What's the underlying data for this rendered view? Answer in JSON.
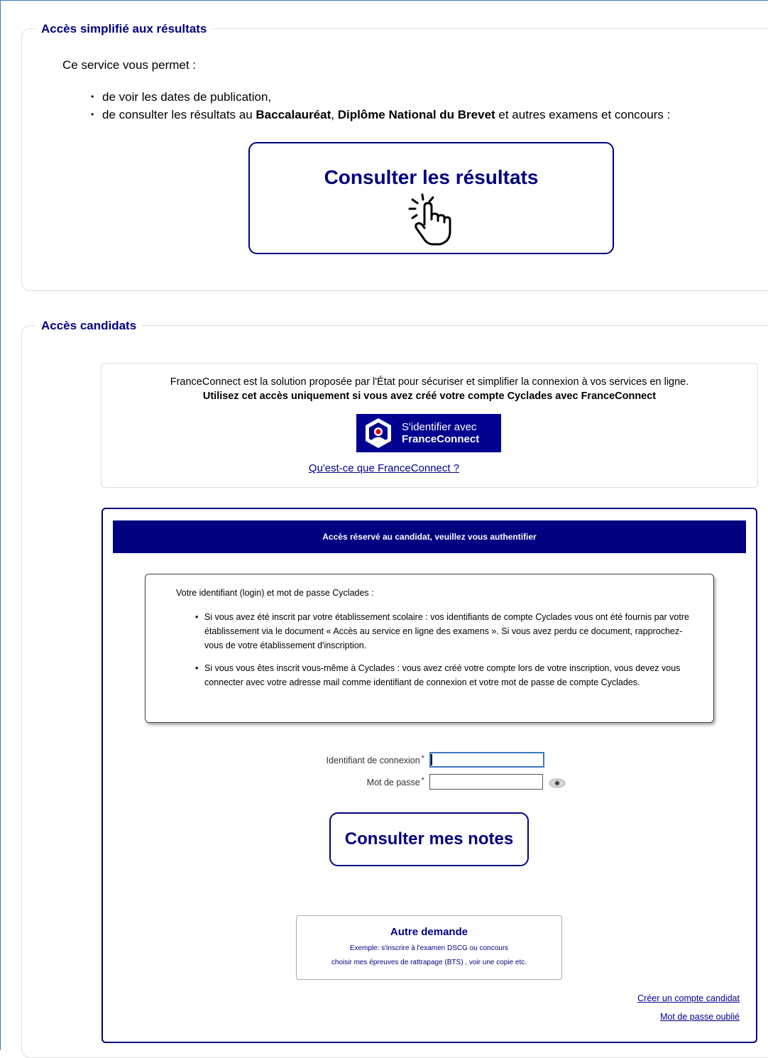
{
  "results_section": {
    "legend": "Accès simplifié aux résultats",
    "intro": "Ce service vous permet :",
    "bullet1": "de voir les dates de publication,",
    "bullet2_pre": "de consulter les résultats au ",
    "bullet2_bac": "Baccalauréat",
    "bullet2_sep": ", ",
    "bullet2_dnb": "Diplôme National du Brevet",
    "bullet2_post": " et autres examens et concours :",
    "button_label": "Consulter les résultats",
    "button_icon": "pointer-hand-icon"
  },
  "candidates_section": {
    "legend": "Accès candidats",
    "franceconnect": {
      "description": "FranceConnect est la solution proposée par l'État pour sécuriser et simplifier la connexion à vos services en ligne.",
      "warning": "Utilisez cet accès uniquement si vous avez créé votre compte Cyclades avec FranceConnect",
      "button_line1": "S'identifier avec",
      "button_line2": "FranceConnect",
      "button_color": "#000091",
      "help_link": "Qu'est-ce que FranceConnect ?"
    },
    "auth": {
      "header": "Accès réservé au candidat, veuillez vous authentifier",
      "header_color": "#000080",
      "info_lead": "Votre identifiant (login) et mot de passe Cyclades :",
      "info_item1": "Si vous avez été inscrit par votre établissement scolaire : vos identifiants de compte Cyclades vous ont été fournis par votre établissement via le document « Accès au service en ligne des examens ». Si vous avez perdu ce document, rapprochez-vous de votre établissement d'inscription.",
      "info_item2": "Si vous vous êtes inscrit vous-même à Cyclades : vous avez créé votre compte lors de votre inscription, vous devez vous connecter avec votre adresse mail comme identifiant de connexion et votre mot de passe de compte Cyclades.",
      "login_label": "Identifiant de connexion",
      "password_label": "Mot de passe",
      "required_mark": "*",
      "login_value": "",
      "password_value": "",
      "eye_icon": "eye-icon",
      "submit_label": "Consulter mes notes",
      "other_title": "Autre demande",
      "other_line1": "Exemple: s'inscrire à l'examen DSCG ou concours",
      "other_line2": "choisir mes épreuves de rattrapage (BTS) , voir une copie etc.",
      "create_account_link": "Créer un compte candidat",
      "forgot_password_link": "Mot de passe oublié"
    }
  }
}
